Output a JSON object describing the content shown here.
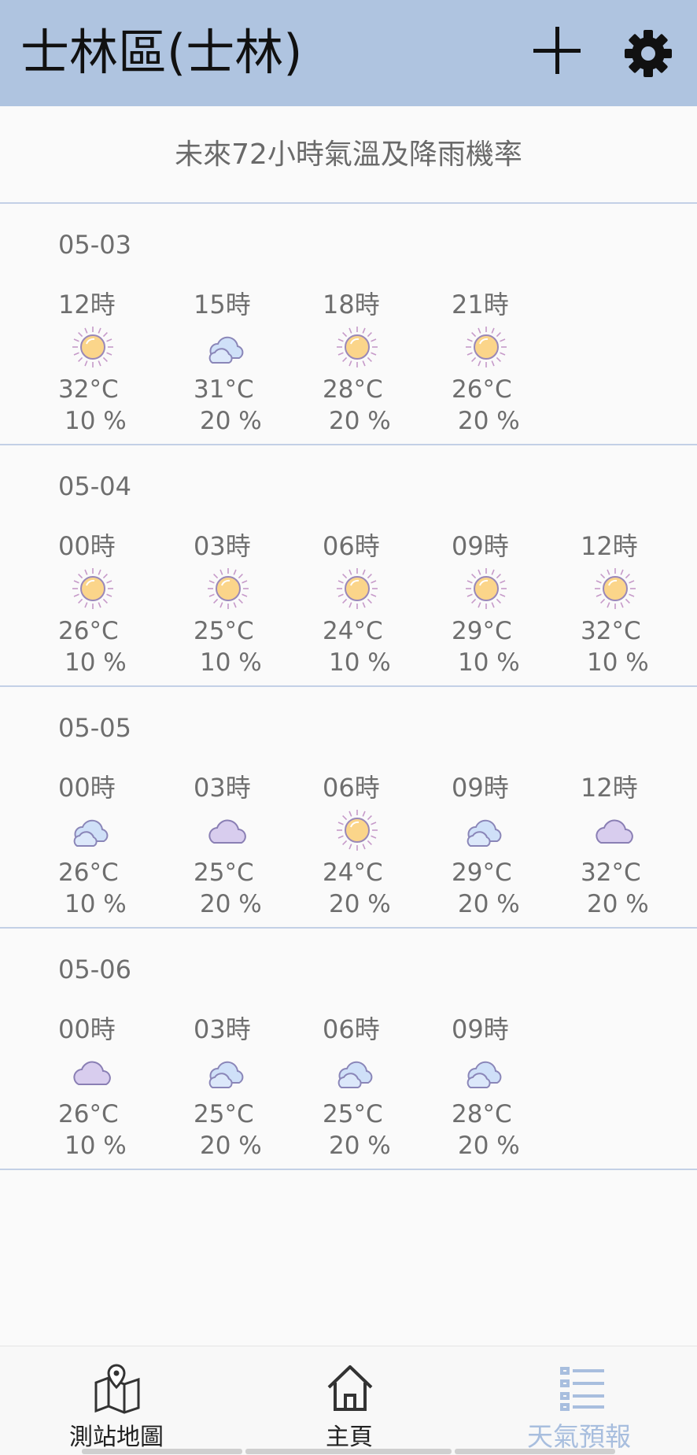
{
  "header": {
    "title": "士林區(士林)",
    "add_icon": "plus-icon",
    "settings_icon": "gear-icon"
  },
  "subtitle": "未來72小時氣溫及降雨機率",
  "days": [
    {
      "date": "05-03",
      "slots": [
        {
          "hour": "12時",
          "icon": "sun",
          "temp": "32°C",
          "rain": "10 %"
        },
        {
          "hour": "15時",
          "icon": "cloud-blue",
          "temp": "31°C",
          "rain": "20 %"
        },
        {
          "hour": "18時",
          "icon": "sun",
          "temp": "28°C",
          "rain": "20 %"
        },
        {
          "hour": "21時",
          "icon": "sun",
          "temp": "26°C",
          "rain": "20 %"
        }
      ]
    },
    {
      "date": "05-04",
      "slots": [
        {
          "hour": "00時",
          "icon": "sun",
          "temp": "26°C",
          "rain": "10 %"
        },
        {
          "hour": "03時",
          "icon": "sun",
          "temp": "25°C",
          "rain": "10 %"
        },
        {
          "hour": "06時",
          "icon": "sun",
          "temp": "24°C",
          "rain": "10 %"
        },
        {
          "hour": "09時",
          "icon": "sun",
          "temp": "29°C",
          "rain": "10 %"
        },
        {
          "hour": "12時",
          "icon": "sun",
          "temp": "32°C",
          "rain": "10 %"
        }
      ]
    },
    {
      "date": "05-05",
      "slots": [
        {
          "hour": "00時",
          "icon": "cloud-blue",
          "temp": "26°C",
          "rain": "10 %"
        },
        {
          "hour": "03時",
          "icon": "cloud-purple",
          "temp": "25°C",
          "rain": "20 %"
        },
        {
          "hour": "06時",
          "icon": "sun",
          "temp": "24°C",
          "rain": "20 %"
        },
        {
          "hour": "09時",
          "icon": "cloud-blue",
          "temp": "29°C",
          "rain": "20 %"
        },
        {
          "hour": "12時",
          "icon": "cloud-purple",
          "temp": "32°C",
          "rain": "20 %"
        }
      ]
    },
    {
      "date": "05-06",
      "slots": [
        {
          "hour": "00時",
          "icon": "cloud-purple",
          "temp": "26°C",
          "rain": "10 %"
        },
        {
          "hour": "03時",
          "icon": "cloud-blue",
          "temp": "25°C",
          "rain": "20 %"
        },
        {
          "hour": "06時",
          "icon": "cloud-blue",
          "temp": "25°C",
          "rain": "20 %"
        },
        {
          "hour": "09時",
          "icon": "cloud-blue",
          "temp": "28°C",
          "rain": "20 %"
        }
      ]
    }
  ],
  "nav": [
    {
      "label": "測站地圖",
      "icon": "map-pin-icon",
      "active": false
    },
    {
      "label": "主頁",
      "icon": "home-icon",
      "active": false
    },
    {
      "label": "天氣預報",
      "icon": "forecast-list-icon",
      "active": true
    }
  ],
  "colors": {
    "header_bg": "#afc4e0",
    "divider": "#c3d0e6",
    "active_nav": "#a8bede"
  }
}
